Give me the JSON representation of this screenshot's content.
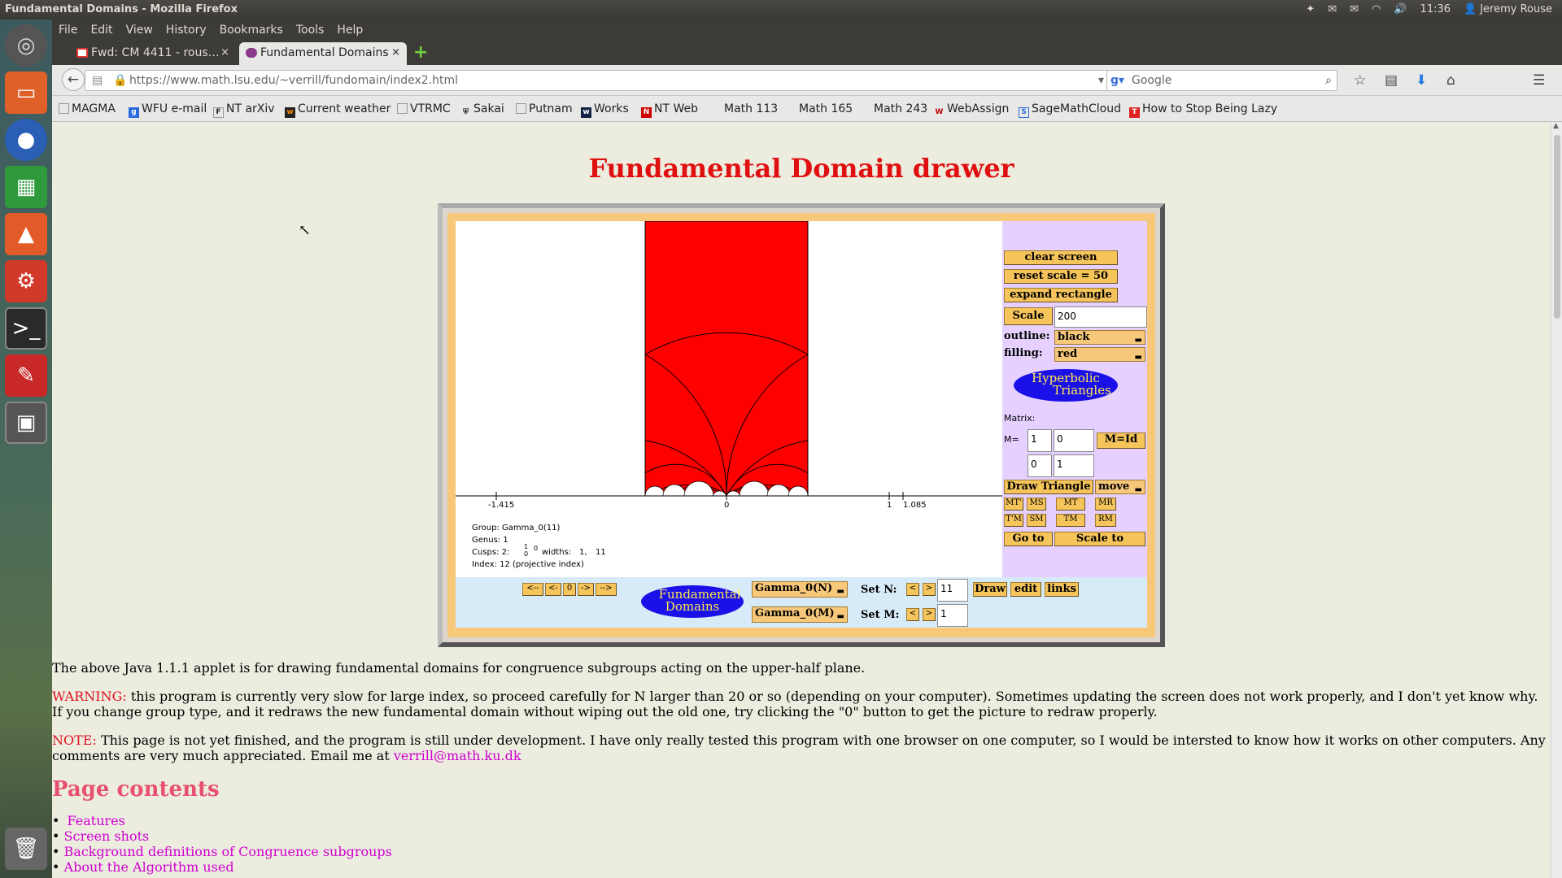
{
  "window_title": "Fundamental Domains - Mozilla Firefox",
  "tray": {
    "time": "11:36",
    "user": "Jeremy Rouse"
  },
  "menu": [
    "File",
    "Edit",
    "View",
    "History",
    "Bookmarks",
    "Tools",
    "Help"
  ],
  "tabs": [
    {
      "label": "Fwd: CM 4411 - rous…",
      "close": "×"
    },
    {
      "label": "Fundamental Domains",
      "close": "×"
    }
  ],
  "new_tab": "+",
  "url": "https://www.math.lsu.edu/~verrill/fundomain/index2.html",
  "search_placeholder": "Google",
  "bookmarks": [
    {
      "label": "MAGMA",
      "icon": "page-icon"
    },
    {
      "label": "WFU e-mail",
      "icon": "g-icon"
    },
    {
      "label": "NT arXiv",
      "icon": "f-icon"
    },
    {
      "label": "Current weather",
      "icon": "weather-icon"
    },
    {
      "label": "VTRMC",
      "icon": "page-icon"
    },
    {
      "label": "Sakai",
      "icon": "shield-icon"
    },
    {
      "label": "Putnam",
      "icon": "page-icon"
    },
    {
      "label": "Works",
      "icon": "works-icon"
    },
    {
      "label": "NT Web",
      "icon": "ntweb-icon"
    },
    {
      "label": "Math 113",
      "icon": ""
    },
    {
      "label": "Math 165",
      "icon": ""
    },
    {
      "label": "Math 243",
      "icon": ""
    },
    {
      "label": "WebAssign",
      "icon": "wa-icon"
    },
    {
      "label": "SageMathCloud",
      "icon": "sage-icon"
    },
    {
      "label": "How to Stop Being Lazy",
      "icon": "t-icon"
    }
  ],
  "page": {
    "title": "Fundamental Domain drawer",
    "applet": {
      "axis_labels": [
        "-1.415",
        "0",
        "1",
        "1.085"
      ],
      "info": {
        "group": "Group: Gamma_0(11)",
        "genus": "Genus: 1",
        "cusps": "Cusps: 2:",
        "cusp_frac_num": "1",
        "cusp_frac_den": "0",
        "cusp_zero": "0",
        "widths": "widths:",
        "width1": "1,",
        "width2": "11",
        "index": "Index: 12 (projective index)"
      },
      "controls": {
        "clear_screen": "clear screen",
        "reset_scale": "reset scale = 50",
        "expand_rectangle": "expand rectangle",
        "scale_btn": "Scale",
        "scale_value": "200",
        "outline_label": "outline:",
        "outline_value": "black",
        "filling_label": "filling:",
        "filling_value": "red",
        "hyperbolic_line1": "Hyperbolic",
        "hyperbolic_line2": "Triangles",
        "matrix_label": "Matrix:",
        "m_eq": "M=",
        "m11": "1",
        "m12": "0",
        "m21": "0",
        "m22": "1",
        "m_id": "M=Id",
        "draw_triangle": "Draw Triangle",
        "move": "move",
        "mt_prime": "MT'",
        "ms": "MS",
        "mt": "MT",
        "mr": "MR",
        "tprime_m": "T'M",
        "sm": "SM",
        "tm": "TM",
        "rm": "RM",
        "go_to": "Go to",
        "scale_to": "Scale to"
      },
      "bottom": {
        "nav": [
          "<--",
          "<-",
          "0",
          "->",
          "-->"
        ],
        "fd_line1": "Fundamental",
        "fd_line2": "Domains",
        "group_n": "Gamma_0(N)",
        "group_m": "Gamma_0(M)",
        "set_n": "Set N:",
        "set_m": "Set M:",
        "lt": "<",
        "gt": ">",
        "n_value": "11",
        "m_value": "1",
        "draw": "Draw",
        "edit": "edit",
        "links": "links"
      }
    },
    "para1": "The above Java 1.1.1 applet is for drawing fundamental domains for congruence subgroups acting on the upper-half plane.",
    "warning_label": "WARNING:",
    "warning_text": " this program is currently very slow for large index, so proceed carefully for N larger than 20 or so (depending on your computer). Sometimes updating the screen does not work properly, and I don't yet know why. If you change group type, and it redraws the new fundamental domain without wiping out the old one, try clicking the \"0\" button to get the picture to redraw properly.",
    "note_label": "NOTE:",
    "note_text": " This page is not yet finished, and the program is still under development. I have only really tested this program with one browser on one computer, so I would be intersted to know how it works on other computers. Any comments are very much appreciated. Email me at ",
    "email": "verrill@math.ku.dk",
    "contents_title": "Page contents",
    "toc": [
      "Features",
      "Screen shots",
      "Background definitions of Congruence subgroups",
      "About the Algorithm used"
    ]
  }
}
